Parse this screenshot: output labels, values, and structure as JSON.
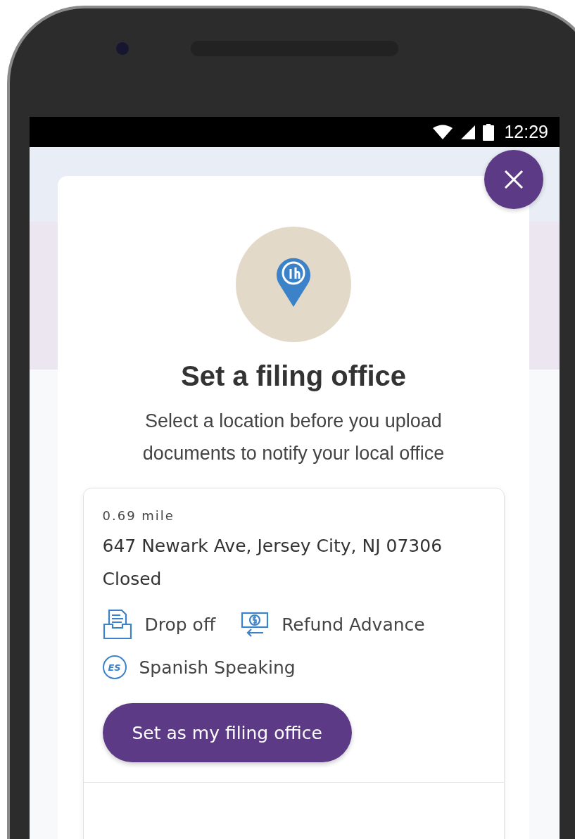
{
  "status_bar": {
    "time": "12:29"
  },
  "modal": {
    "title": "Set a filing office",
    "subtitle": "Select a location before you upload documents to notify your local office"
  },
  "office": {
    "distance": "0.69 mile",
    "address": "647 Newark Ave, Jersey City, NJ 07306",
    "status": "Closed",
    "services": [
      {
        "kind": "dropoff",
        "label": "Drop off"
      },
      {
        "kind": "refund",
        "label": "Refund Advance"
      },
      {
        "kind": "spanish",
        "label": "Spanish Speaking",
        "badge": "ES"
      }
    ],
    "button": "Set as my filing office"
  }
}
